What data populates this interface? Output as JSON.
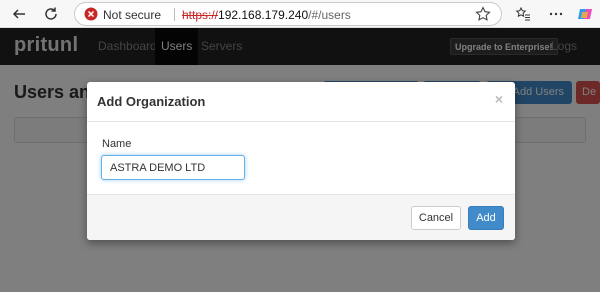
{
  "browser": {
    "not_secure": "Not secure",
    "url_protocol": "https://",
    "url_host": "192.168.179.240",
    "url_path": "/#/users"
  },
  "app": {
    "brand": "pritunl",
    "nav": [
      "Dashboard",
      "Users",
      "Servers"
    ],
    "upgrade": "Upgrade to Enterprise!",
    "logs": "Logs",
    "page_title": "Users and",
    "top_buttons": [
      "Add Users",
      "De"
    ]
  },
  "modal": {
    "title": "Add Organization",
    "close": "×",
    "name_label": "Name",
    "name_value": "ASTRA DEMO LTD",
    "cancel": "Cancel",
    "add": "Add"
  },
  "colors": {
    "primary": "#428bca",
    "danger": "#d9534f",
    "navbar": "#222222",
    "warning": "#c62828"
  }
}
